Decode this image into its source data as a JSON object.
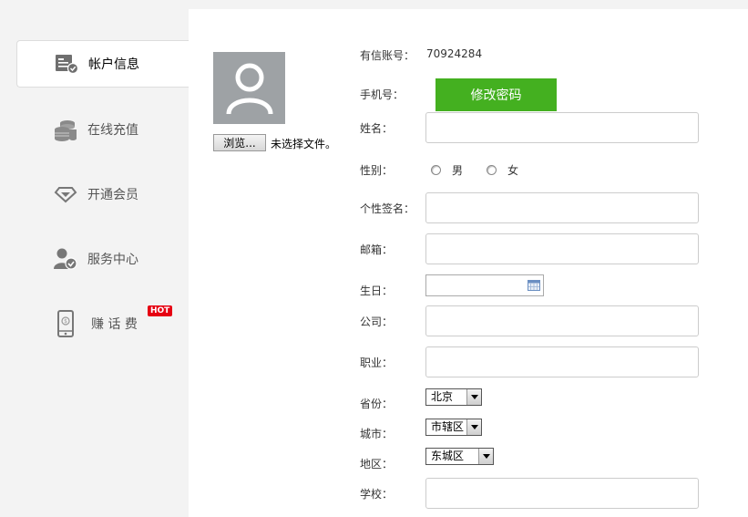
{
  "sidebar": {
    "items": [
      {
        "label": "帐户信息",
        "icon": "account-info-icon",
        "active": true
      },
      {
        "label": "在线充值",
        "icon": "coins-icon",
        "active": false
      },
      {
        "label": "开通会员",
        "icon": "diamond-icon",
        "active": false
      },
      {
        "label": "服务中心",
        "icon": "user-service-icon",
        "active": false
      },
      {
        "label": "赚 话 费",
        "icon": "phone-icon",
        "active": false,
        "badge": "HOT"
      }
    ]
  },
  "avatar": {
    "browse_label": "浏览...",
    "file_status": "未选择文件。"
  },
  "form": {
    "account_label": "有信账号：",
    "account_value": "70924284",
    "phone_label": "手机号：",
    "change_password_label": "修改密码",
    "name_label": "姓名：",
    "name_value": "",
    "gender_label": "性别：",
    "gender_male": "男",
    "gender_female": "女",
    "signature_label": "个性签名：",
    "signature_value": "",
    "email_label": "邮箱：",
    "email_value": "",
    "birthday_label": "生日：",
    "birthday_value": "",
    "company_label": "公司：",
    "company_value": "",
    "job_label": "职业：",
    "job_value": "",
    "province_label": "省份：",
    "province_value": "北京",
    "city_label": "城市：",
    "city_value": "市辖区",
    "district_label": "地区：",
    "district_value": "东城区",
    "school_label": "学校：",
    "school_value": ""
  },
  "colors": {
    "accent_green": "#44b020",
    "hot_red": "#e60012"
  }
}
